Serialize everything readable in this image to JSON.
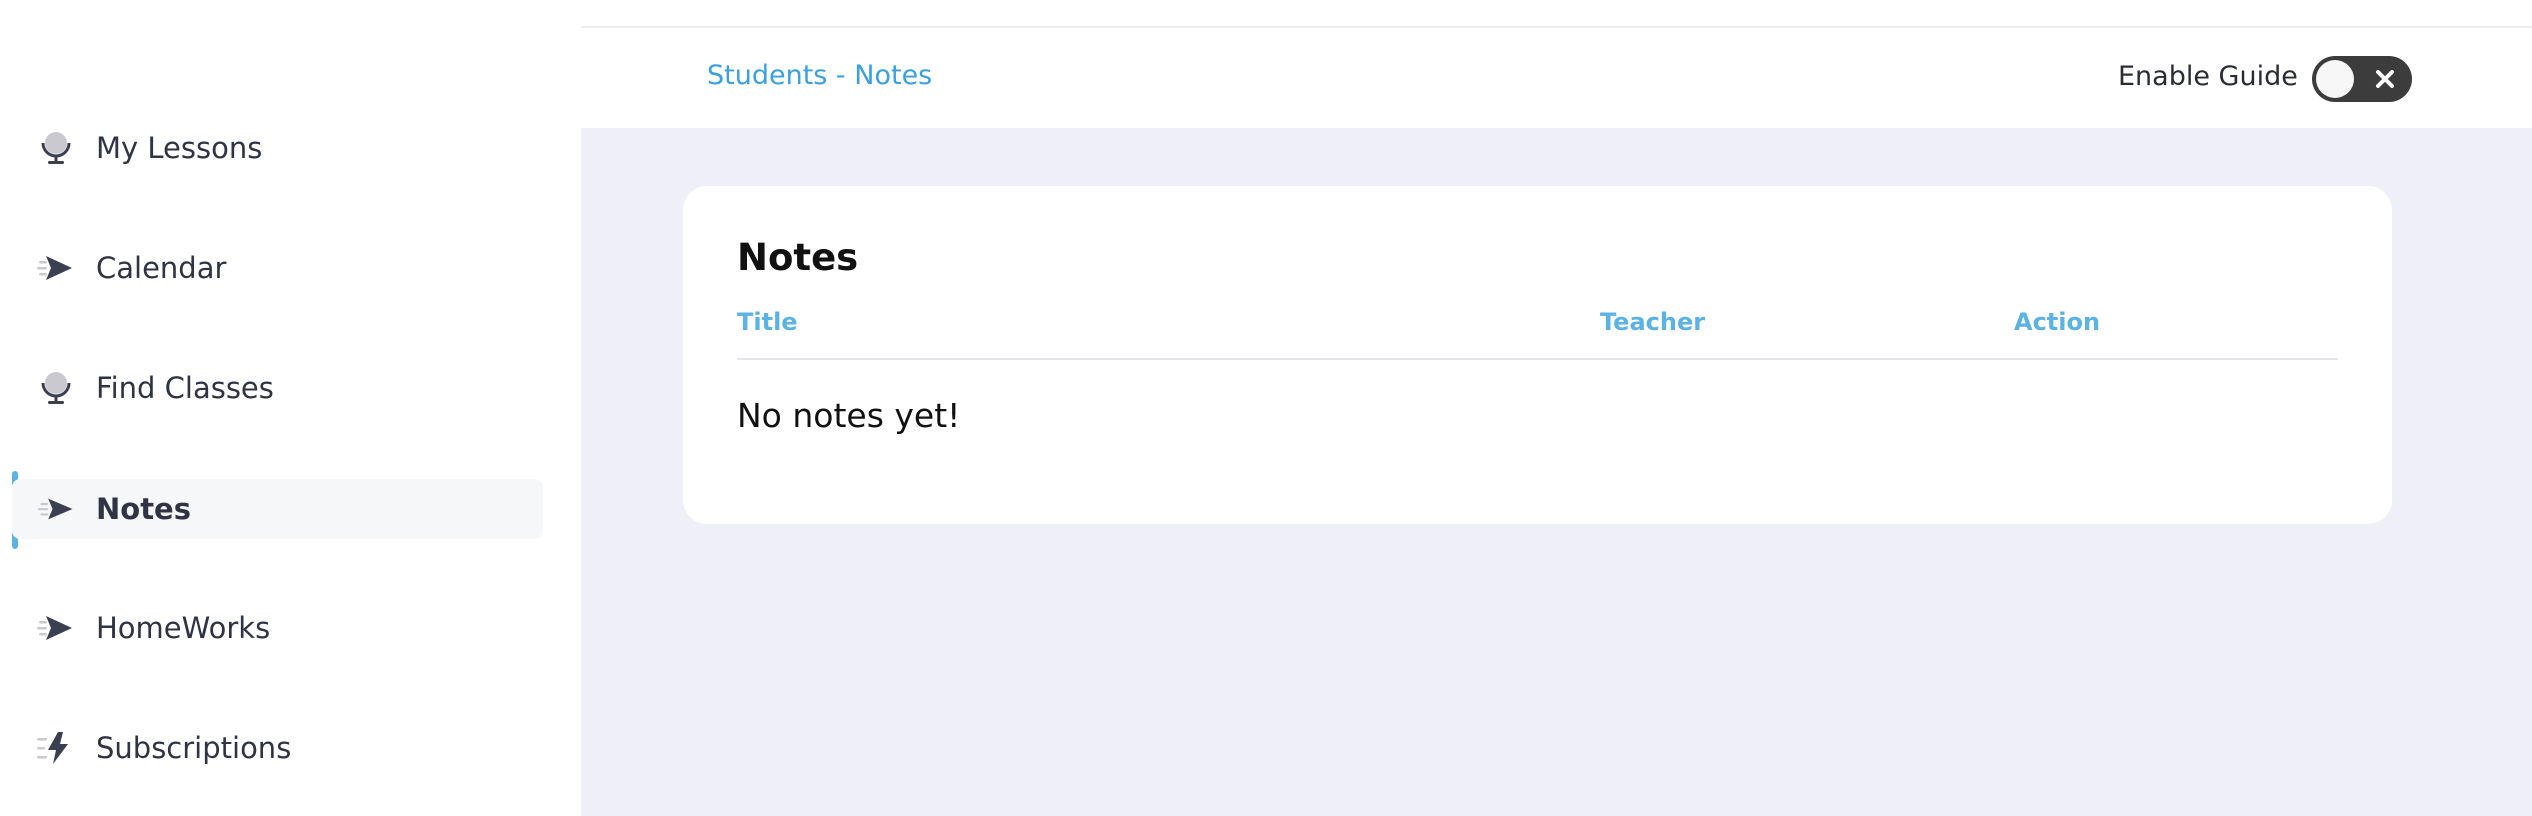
{
  "sidebar": {
    "items": [
      {
        "label": "My Lessons",
        "icon": "lesson-icon"
      },
      {
        "label": "Calendar",
        "icon": "send-icon"
      },
      {
        "label": "Find Classes",
        "icon": "lesson-icon"
      },
      {
        "label": "Notes",
        "icon": "send-icon",
        "active": true
      },
      {
        "label": "HomeWorks",
        "icon": "send-icon"
      },
      {
        "label": "Subscriptions",
        "icon": "bolt-icon"
      }
    ]
  },
  "header": {
    "breadcrumb": "Students - Notes",
    "guide_label": "Enable Guide",
    "guide_enabled": false
  },
  "notes_card": {
    "title": "Notes",
    "columns": [
      "Title",
      "Teacher",
      "Action"
    ],
    "empty_message": "No notes yet!"
  },
  "colors": {
    "accent": "#5ab3e2",
    "breadcrumb": "#3aa0e0",
    "main_bg": "#efeff7",
    "toggle_bg": "#3c3c3c"
  }
}
